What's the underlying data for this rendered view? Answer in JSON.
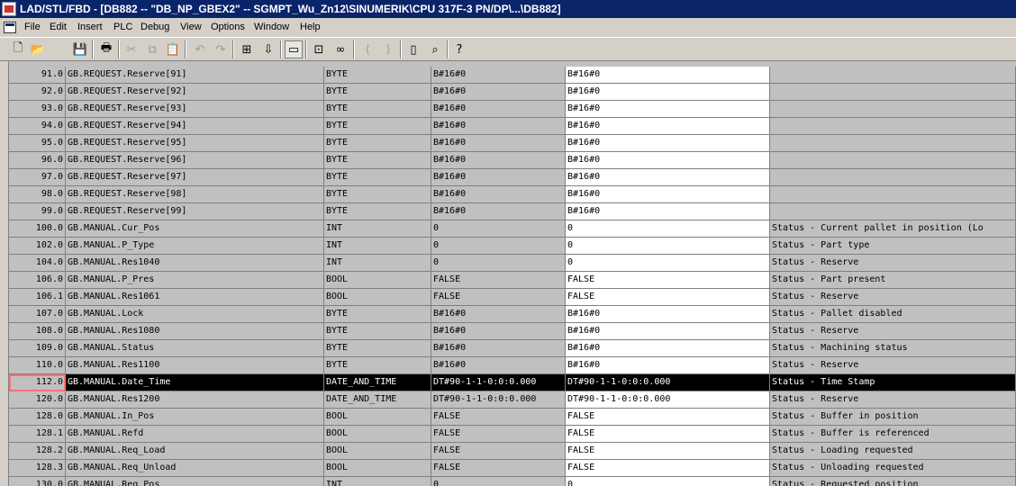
{
  "window": {
    "title": "LAD/STL/FBD  - [DB882 -- \"DB_NP_GBEX2\" -- SGMPT_Wu_Zn12\\SINUMERIK\\CPU 317F-3 PN/DP\\...\\DB882]"
  },
  "menu": [
    "File",
    "Edit",
    "Insert",
    "PLC",
    "Debug",
    "View",
    "Options",
    "Window",
    "Help"
  ],
  "toolbar": {
    "buttons": [
      {
        "icon": "new-icon",
        "glyph": "🗋"
      },
      {
        "icon": "open-icon",
        "glyph": "📂"
      },
      {
        "icon": "save-icon",
        "glyph": "💾"
      },
      {
        "icon": "print-icon",
        "glyph": "🖶"
      },
      {
        "icon": "cut-icon",
        "glyph": "✂"
      },
      {
        "icon": "copy-icon",
        "glyph": "⧉"
      },
      {
        "icon": "paste-icon",
        "glyph": "📋"
      },
      {
        "icon": "undo-icon",
        "glyph": "↶"
      },
      {
        "icon": "redo-icon",
        "glyph": "↷"
      },
      {
        "icon": "monitor-icon",
        "glyph": "⊞"
      },
      {
        "icon": "download-icon",
        "glyph": "⇩"
      },
      {
        "icon": "overview-icon",
        "glyph": "▭"
      },
      {
        "icon": "network-icon",
        "glyph": "⊡"
      },
      {
        "icon": "glasses-icon",
        "glyph": "∞"
      },
      {
        "icon": "prev-error-icon",
        "glyph": "⟨"
      },
      {
        "icon": "next-error-icon",
        "glyph": "⟩"
      },
      {
        "icon": "window-icon",
        "glyph": "▯"
      },
      {
        "icon": "zoom-icon",
        "glyph": "⌕"
      },
      {
        "icon": "help-icon",
        "glyph": "?"
      }
    ]
  },
  "table": {
    "rows": [
      {
        "address": "91.0",
        "name": "GB.REQUEST.Reserve[91]",
        "type": "BYTE",
        "initial": "B#16#0",
        "actual": "B#16#0",
        "comment": ""
      },
      {
        "address": "92.0",
        "name": "GB.REQUEST.Reserve[92]",
        "type": "BYTE",
        "initial": "B#16#0",
        "actual": "B#16#0",
        "comment": ""
      },
      {
        "address": "93.0",
        "name": "GB.REQUEST.Reserve[93]",
        "type": "BYTE",
        "initial": "B#16#0",
        "actual": "B#16#0",
        "comment": ""
      },
      {
        "address": "94.0",
        "name": "GB.REQUEST.Reserve[94]",
        "type": "BYTE",
        "initial": "B#16#0",
        "actual": "B#16#0",
        "comment": ""
      },
      {
        "address": "95.0",
        "name": "GB.REQUEST.Reserve[95]",
        "type": "BYTE",
        "initial": "B#16#0",
        "actual": "B#16#0",
        "comment": ""
      },
      {
        "address": "96.0",
        "name": "GB.REQUEST.Reserve[96]",
        "type": "BYTE",
        "initial": "B#16#0",
        "actual": "B#16#0",
        "comment": ""
      },
      {
        "address": "97.0",
        "name": "GB.REQUEST.Reserve[97]",
        "type": "BYTE",
        "initial": "B#16#0",
        "actual": "B#16#0",
        "comment": ""
      },
      {
        "address": "98.0",
        "name": "GB.REQUEST.Reserve[98]",
        "type": "BYTE",
        "initial": "B#16#0",
        "actual": "B#16#0",
        "comment": ""
      },
      {
        "address": "99.0",
        "name": "GB.REQUEST.Reserve[99]",
        "type": "BYTE",
        "initial": "B#16#0",
        "actual": "B#16#0",
        "comment": ""
      },
      {
        "address": "100.0",
        "name": "GB.MANUAL.Cur_Pos",
        "type": "INT",
        "initial": "0",
        "actual": "0",
        "comment": "Status - Current pallet in position (Lo"
      },
      {
        "address": "102.0",
        "name": "GB.MANUAL.P_Type",
        "type": "INT",
        "initial": "0",
        "actual": "0",
        "comment": "Status - Part type"
      },
      {
        "address": "104.0",
        "name": "GB.MANUAL.Res1040",
        "type": "INT",
        "initial": "0",
        "actual": "0",
        "comment": "Status - Reserve"
      },
      {
        "address": "106.0",
        "name": "GB.MANUAL.P_Pres",
        "type": "BOOL",
        "initial": "FALSE",
        "actual": "FALSE",
        "comment": "Status - Part present"
      },
      {
        "address": "106.1",
        "name": "GB.MANUAL.Res1061",
        "type": "BOOL",
        "initial": "FALSE",
        "actual": "FALSE",
        "comment": "Status - Reserve"
      },
      {
        "address": "107.0",
        "name": "GB.MANUAL.Lock",
        "type": "BYTE",
        "initial": "B#16#0",
        "actual": "B#16#0",
        "comment": "Status - Pallet disabled"
      },
      {
        "address": "108.0",
        "name": "GB.MANUAL.Res1080",
        "type": "BYTE",
        "initial": "B#16#0",
        "actual": "B#16#0",
        "comment": "Status - Reserve"
      },
      {
        "address": "109.0",
        "name": "GB.MANUAL.Status",
        "type": "BYTE",
        "initial": "B#16#0",
        "actual": "B#16#0",
        "comment": "Status - Machining status"
      },
      {
        "address": "110.0",
        "name": "GB.MANUAL.Res1100",
        "type": "BYTE",
        "initial": "B#16#0",
        "actual": "B#16#0",
        "comment": "Status - Reserve"
      },
      {
        "address": "112.0",
        "name": "GB.MANUAL.Date_Time",
        "type": "DATE_AND_TIME",
        "initial": "DT#90-1-1-0:0:0.000",
        "actual": "DT#90-1-1-0:0:0.000",
        "comment": "Status - Time Stamp",
        "selected": true
      },
      {
        "address": "120.0",
        "name": "GB.MANUAL.Res1200",
        "type": "DATE_AND_TIME",
        "initial": "DT#90-1-1-0:0:0.000",
        "actual": "DT#90-1-1-0:0:0.000",
        "comment": "Status - Reserve"
      },
      {
        "address": "128.0",
        "name": "GB.MANUAL.In_Pos",
        "type": "BOOL",
        "initial": "FALSE",
        "actual": "FALSE",
        "comment": "Status - Buffer in position"
      },
      {
        "address": "128.1",
        "name": "GB.MANUAL.Refd",
        "type": "BOOL",
        "initial": "FALSE",
        "actual": "FALSE",
        "comment": "Status - Buffer is referenced"
      },
      {
        "address": "128.2",
        "name": "GB.MANUAL.Req_Load",
        "type": "BOOL",
        "initial": "FALSE",
        "actual": "FALSE",
        "comment": "Status - Loading requested"
      },
      {
        "address": "128.3",
        "name": "GB.MANUAL.Req_Unload",
        "type": "BOOL",
        "initial": "FALSE",
        "actual": "FALSE",
        "comment": "Status - Unloading requested"
      },
      {
        "address": "130.0",
        "name": "GB.MANUAL.Req_Pos",
        "type": "INT",
        "initial": "0",
        "actual": "0",
        "comment": "Status - Requested position"
      }
    ]
  }
}
